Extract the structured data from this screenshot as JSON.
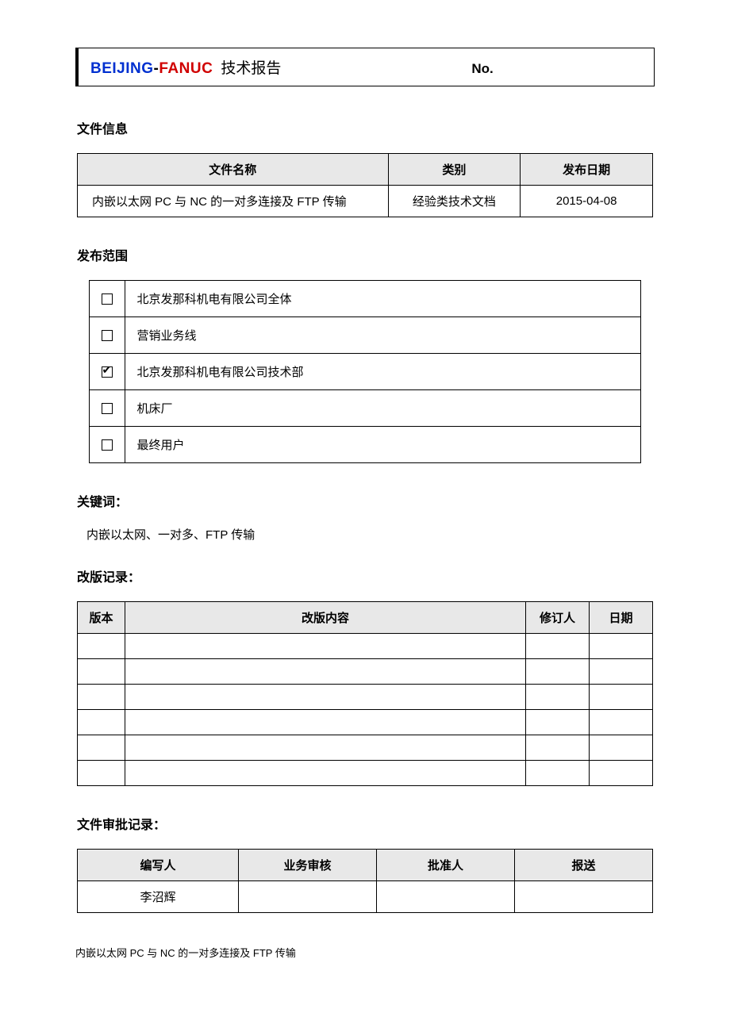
{
  "header": {
    "brand_beijing": "BEIJING",
    "brand_dash": "-",
    "brand_fanuc": "FANUC",
    "report_label": "技术报告",
    "no_label": "No."
  },
  "sections": {
    "file_info": "文件信息",
    "scope": "发布范围",
    "keywords_label": "关键词：",
    "keywords_text": "内嵌以太网、一对多、FTP 传输",
    "revision": "改版记录：",
    "approval": "文件审批记录："
  },
  "file_info_table": {
    "headers": {
      "name": "文件名称",
      "category": "类别",
      "date": "发布日期"
    },
    "row": {
      "name": "内嵌以太网 PC 与 NC 的一对多连接及 FTP 传输",
      "category": "经验类技术文档",
      "date": "2015-04-08"
    }
  },
  "scope_items": [
    {
      "checked": false,
      "label": "北京发那科机电有限公司全体"
    },
    {
      "checked": false,
      "label": "营销业务线"
    },
    {
      "checked": true,
      "label": "北京发那科机电有限公司技术部"
    },
    {
      "checked": false,
      "label": "机床厂"
    },
    {
      "checked": false,
      "label": "最终用户"
    }
  ],
  "revision_table": {
    "headers": {
      "version": "版本",
      "content": "改版内容",
      "reviser": "修订人",
      "date": "日期"
    },
    "rows": [
      {
        "version": "",
        "content": "",
        "reviser": "",
        "date": ""
      },
      {
        "version": "",
        "content": "",
        "reviser": "",
        "date": ""
      },
      {
        "version": "",
        "content": "",
        "reviser": "",
        "date": ""
      },
      {
        "version": "",
        "content": "",
        "reviser": "",
        "date": ""
      },
      {
        "version": "",
        "content": "",
        "reviser": "",
        "date": ""
      },
      {
        "version": "",
        "content": "",
        "reviser": "",
        "date": ""
      }
    ]
  },
  "approval_table": {
    "headers": {
      "author": "编写人",
      "review": "业务审核",
      "approver": "批准人",
      "cc": "报送"
    },
    "row": {
      "author": "李沼辉",
      "review": "",
      "approver": "",
      "cc": ""
    }
  },
  "footer": "内嵌以太网 PC 与 NC 的一对多连接及 FTP 传输"
}
